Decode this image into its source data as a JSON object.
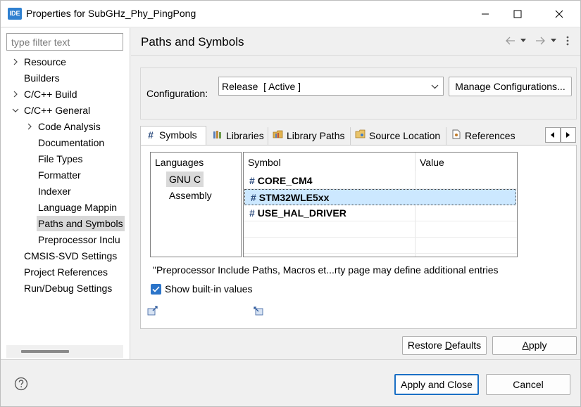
{
  "window": {
    "app_icon_text": "IDE",
    "title": "Properties for SubGHz_Phy_PingPong"
  },
  "left": {
    "filter_placeholder": "type filter text",
    "tree": [
      {
        "label": "Resource",
        "expandable": true,
        "expanded": false,
        "level": 0
      },
      {
        "label": "Builders",
        "expandable": false,
        "level": 0
      },
      {
        "label": "C/C++ Build",
        "expandable": true,
        "expanded": false,
        "level": 0
      },
      {
        "label": "C/C++ General",
        "expandable": true,
        "expanded": true,
        "level": 0
      },
      {
        "label": "Code Analysis",
        "expandable": true,
        "expanded": false,
        "level": 1
      },
      {
        "label": "Documentation",
        "expandable": false,
        "level": 1
      },
      {
        "label": "File Types",
        "expandable": false,
        "level": 1
      },
      {
        "label": "Formatter",
        "expandable": false,
        "level": 1
      },
      {
        "label": "Indexer",
        "expandable": false,
        "level": 1
      },
      {
        "label": "Language Mappin",
        "expandable": false,
        "level": 1
      },
      {
        "label": "Paths and Symbols",
        "expandable": false,
        "level": 1,
        "selected": true
      },
      {
        "label": "Preprocessor Inclu",
        "expandable": false,
        "level": 1
      },
      {
        "label": "CMSIS-SVD Settings",
        "expandable": false,
        "level": 0
      },
      {
        "label": "Project References",
        "expandable": false,
        "level": 0
      },
      {
        "label": "Run/Debug Settings",
        "expandable": false,
        "level": 0
      }
    ]
  },
  "page": {
    "title": "Paths and Symbols",
    "configuration_label": "Configuration:",
    "configuration_value": "Release  [ Active ]",
    "manage_button": "Manage Configurations...",
    "tabs": [
      {
        "label": "Symbols",
        "icon": "hash-icon",
        "active": true
      },
      {
        "label": "Libraries",
        "icon": "library-icon",
        "active": false
      },
      {
        "label": "Library Paths",
        "icon": "library-paths-icon",
        "active": false
      },
      {
        "label": "Source Location",
        "icon": "folder-icon",
        "active": false
      },
      {
        "label": "References",
        "icon": "references-icon",
        "active": false
      }
    ],
    "languages_header": "Languages",
    "languages": [
      {
        "label": "GNU C",
        "selected": true
      },
      {
        "label": "Assembly",
        "selected": false
      }
    ],
    "table_headers": {
      "symbol": "Symbol",
      "value": "Value"
    },
    "symbols": [
      {
        "name": "CORE_CM4",
        "value": "",
        "selected": false
      },
      {
        "name": "STM32WLE5xx",
        "value": "",
        "selected": true
      },
      {
        "name": "USE_HAL_DRIVER",
        "value": "",
        "selected": false
      }
    ],
    "symbol_prefix": "#",
    "note": "\"Preprocessor Include Paths, Macros et...rty page may define additional entries",
    "show_builtin_label": "Show built-in values",
    "show_builtin_checked": true,
    "restore_defaults_prefix": "Restore ",
    "restore_defaults_underlined": "D",
    "restore_defaults_suffix": "efaults",
    "apply_underlined": "A",
    "apply_suffix": "pply"
  },
  "bottom": {
    "apply_close": "Apply and Close",
    "cancel": "Cancel"
  },
  "colors": {
    "accent": "#2b74c9",
    "selection": "#cce8ff",
    "app_icon": "#2f80d0"
  }
}
